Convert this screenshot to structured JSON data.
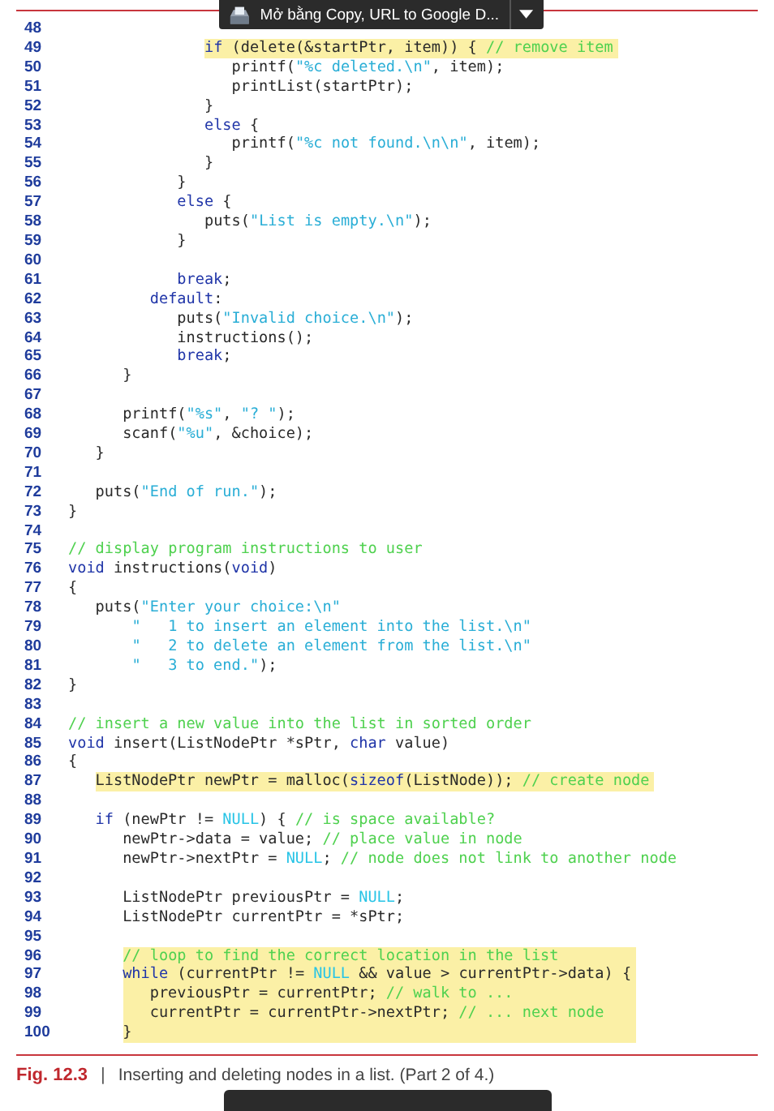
{
  "toolbar": {
    "title": "Mở bằng Copy, URL to Google D..."
  },
  "listing": {
    "lines": [
      {
        "number": "48",
        "highlighted": false
      },
      {
        "number": "49",
        "highlighted": true,
        "segments": [
          {
            "kind": "keyword",
            "text": "               if"
          },
          {
            "kind": "plain",
            "text": " (delete(&startPtr, item)) { "
          },
          {
            "kind": "comment",
            "text": "// remove item"
          }
        ]
      },
      {
        "number": "50",
        "highlighted": false,
        "segments": [
          {
            "kind": "plain",
            "text": "                  printf("
          },
          {
            "kind": "string",
            "text": "\"%c deleted.\\n\""
          },
          {
            "kind": "plain",
            "text": ", item);"
          }
        ]
      },
      {
        "number": "51",
        "highlighted": false,
        "segments": [
          {
            "kind": "plain",
            "text": "                  printList(startPtr);"
          }
        ]
      },
      {
        "number": "52",
        "highlighted": false,
        "segments": [
          {
            "kind": "plain",
            "text": "               }"
          }
        ]
      },
      {
        "number": "53",
        "highlighted": false,
        "segments": [
          {
            "kind": "keyword",
            "text": "               else"
          },
          {
            "kind": "plain",
            "text": " {"
          }
        ]
      },
      {
        "number": "54",
        "highlighted": false,
        "segments": [
          {
            "kind": "plain",
            "text": "                  printf("
          },
          {
            "kind": "string",
            "text": "\"%c not found.\\n\\n\""
          },
          {
            "kind": "plain",
            "text": ", item);"
          }
        ]
      },
      {
        "number": "55",
        "highlighted": false,
        "segments": [
          {
            "kind": "plain",
            "text": "               }"
          }
        ]
      },
      {
        "number": "56",
        "highlighted": false,
        "segments": [
          {
            "kind": "plain",
            "text": "            }"
          }
        ]
      },
      {
        "number": "57",
        "highlighted": false,
        "segments": [
          {
            "kind": "keyword",
            "text": "            else"
          },
          {
            "kind": "plain",
            "text": " {"
          }
        ]
      },
      {
        "number": "58",
        "highlighted": false,
        "segments": [
          {
            "kind": "plain",
            "text": "               puts("
          },
          {
            "kind": "string",
            "text": "\"List is empty.\\n\""
          },
          {
            "kind": "plain",
            "text": ");"
          }
        ]
      },
      {
        "number": "59",
        "highlighted": false,
        "segments": [
          {
            "kind": "plain",
            "text": "            }"
          }
        ]
      },
      {
        "number": "60",
        "highlighted": false
      },
      {
        "number": "61",
        "highlighted": false,
        "segments": [
          {
            "kind": "keyword",
            "text": "            break"
          },
          {
            "kind": "plain",
            "text": ";"
          }
        ]
      },
      {
        "number": "62",
        "highlighted": false,
        "segments": [
          {
            "kind": "keyword",
            "text": "         default"
          },
          {
            "kind": "plain",
            "text": ":"
          }
        ]
      },
      {
        "number": "63",
        "highlighted": false,
        "segments": [
          {
            "kind": "plain",
            "text": "            puts("
          },
          {
            "kind": "string",
            "text": "\"Invalid choice.\\n\""
          },
          {
            "kind": "plain",
            "text": ");"
          }
        ]
      },
      {
        "number": "64",
        "highlighted": false,
        "segments": [
          {
            "kind": "plain",
            "text": "            instructions();"
          }
        ]
      },
      {
        "number": "65",
        "highlighted": false,
        "segments": [
          {
            "kind": "keyword",
            "text": "            break"
          },
          {
            "kind": "plain",
            "text": ";"
          }
        ]
      },
      {
        "number": "66",
        "highlighted": false,
        "segments": [
          {
            "kind": "plain",
            "text": "      }"
          }
        ]
      },
      {
        "number": "67",
        "highlighted": false
      },
      {
        "number": "68",
        "highlighted": false,
        "segments": [
          {
            "kind": "plain",
            "text": "      printf("
          },
          {
            "kind": "string",
            "text": "\"%s\""
          },
          {
            "kind": "plain",
            "text": ", "
          },
          {
            "kind": "string",
            "text": "\"? \""
          },
          {
            "kind": "plain",
            "text": ");"
          }
        ]
      },
      {
        "number": "69",
        "highlighted": false,
        "segments": [
          {
            "kind": "plain",
            "text": "      scanf("
          },
          {
            "kind": "string",
            "text": "\"%u\""
          },
          {
            "kind": "plain",
            "text": ", &choice);"
          }
        ]
      },
      {
        "number": "70",
        "highlighted": false,
        "segments": [
          {
            "kind": "plain",
            "text": "   }"
          }
        ]
      },
      {
        "number": "71",
        "highlighted": false
      },
      {
        "number": "72",
        "highlighted": false,
        "segments": [
          {
            "kind": "plain",
            "text": "   puts("
          },
          {
            "kind": "string",
            "text": "\"End of run.\""
          },
          {
            "kind": "plain",
            "text": ");"
          }
        ]
      },
      {
        "number": "73",
        "highlighted": false,
        "segments": [
          {
            "kind": "plain",
            "text": "}"
          }
        ]
      },
      {
        "number": "74",
        "highlighted": false
      },
      {
        "number": "75",
        "highlighted": false,
        "segments": [
          {
            "kind": "comment",
            "text": "// display program instructions to user"
          }
        ]
      },
      {
        "number": "76",
        "highlighted": false,
        "segments": [
          {
            "kind": "keyword",
            "text": "void"
          },
          {
            "kind": "plain",
            "text": " instructions("
          },
          {
            "kind": "keyword",
            "text": "void"
          },
          {
            "kind": "plain",
            "text": ")"
          }
        ]
      },
      {
        "number": "77",
        "highlighted": false,
        "segments": [
          {
            "kind": "plain",
            "text": "{"
          }
        ]
      },
      {
        "number": "78",
        "highlighted": false,
        "segments": [
          {
            "kind": "plain",
            "text": "   puts("
          },
          {
            "kind": "string",
            "text": "\"Enter your choice:\\n\""
          }
        ]
      },
      {
        "number": "79",
        "highlighted": false,
        "segments": [
          {
            "kind": "string",
            "text": "       \"   1 to insert an element into the list.\\n\""
          }
        ]
      },
      {
        "number": "80",
        "highlighted": false,
        "segments": [
          {
            "kind": "string",
            "text": "       \"   2 to delete an element from the list.\\n\""
          }
        ]
      },
      {
        "number": "81",
        "highlighted": false,
        "segments": [
          {
            "kind": "string",
            "text": "       \"   3 to end.\""
          },
          {
            "kind": "plain",
            "text": ");"
          }
        ]
      },
      {
        "number": "82",
        "highlighted": false,
        "segments": [
          {
            "kind": "plain",
            "text": "}"
          }
        ]
      },
      {
        "number": "83",
        "highlighted": false
      },
      {
        "number": "84",
        "highlighted": false,
        "segments": [
          {
            "kind": "comment",
            "text": "// insert a new value into the list in sorted order"
          }
        ]
      },
      {
        "number": "85",
        "highlighted": false,
        "segments": [
          {
            "kind": "keyword",
            "text": "void"
          },
          {
            "kind": "plain",
            "text": " insert(ListNodePtr *sPtr, "
          },
          {
            "kind": "keyword",
            "text": "char"
          },
          {
            "kind": "plain",
            "text": " value)"
          }
        ]
      },
      {
        "number": "86",
        "highlighted": false,
        "segments": [
          {
            "kind": "plain",
            "text": "{"
          }
        ]
      },
      {
        "number": "87",
        "highlighted": true,
        "segments": [
          {
            "kind": "plain",
            "text": "   ListNodePtr newPtr = malloc("
          },
          {
            "kind": "keyword",
            "text": "sizeof"
          },
          {
            "kind": "plain",
            "text": "(ListNode)); "
          },
          {
            "kind": "comment",
            "text": "// create node"
          }
        ]
      },
      {
        "number": "88",
        "highlighted": false
      },
      {
        "number": "89",
        "highlighted": false,
        "segments": [
          {
            "kind": "keyword",
            "text": "   if"
          },
          {
            "kind": "plain",
            "text": " (newPtr != "
          },
          {
            "kind": "constant",
            "text": "NULL"
          },
          {
            "kind": "plain",
            "text": ") { "
          },
          {
            "kind": "comment",
            "text": "// is space available?"
          }
        ]
      },
      {
        "number": "90",
        "highlighted": false,
        "segments": [
          {
            "kind": "plain",
            "text": "      newPtr->data = value; "
          },
          {
            "kind": "comment",
            "text": "// place value in node"
          }
        ]
      },
      {
        "number": "91",
        "highlighted": false,
        "segments": [
          {
            "kind": "plain",
            "text": "      newPtr->nextPtr = "
          },
          {
            "kind": "constant",
            "text": "NULL"
          },
          {
            "kind": "plain",
            "text": "; "
          },
          {
            "kind": "comment",
            "text": "// node does not link to another node"
          }
        ]
      },
      {
        "number": "92",
        "highlighted": false
      },
      {
        "number": "93",
        "highlighted": false,
        "segments": [
          {
            "kind": "plain",
            "text": "      ListNodePtr previousPtr = "
          },
          {
            "kind": "constant",
            "text": "NULL"
          },
          {
            "kind": "plain",
            "text": ";"
          }
        ]
      },
      {
        "number": "94",
        "highlighted": false,
        "segments": [
          {
            "kind": "plain",
            "text": "      ListNodePtr currentPtr = *sPtr;"
          }
        ]
      },
      {
        "number": "95",
        "highlighted": false
      },
      {
        "number": "96",
        "highlighted": true,
        "segments": [
          {
            "kind": "comment",
            "text": "      // loop to find the correct location in the list"
          }
        ]
      },
      {
        "number": "97",
        "highlighted": true,
        "segments": [
          {
            "kind": "keyword",
            "text": "      while"
          },
          {
            "kind": "plain",
            "text": " (currentPtr != "
          },
          {
            "kind": "constant",
            "text": "NULL"
          },
          {
            "kind": "plain",
            "text": " && value > currentPtr->data) {"
          }
        ]
      },
      {
        "number": "98",
        "highlighted": true,
        "segments": [
          {
            "kind": "plain",
            "text": "         previousPtr = currentPtr; "
          },
          {
            "kind": "comment",
            "text": "// walk to ..."
          }
        ]
      },
      {
        "number": "99",
        "highlighted": true,
        "segments": [
          {
            "kind": "plain",
            "text": "         currentPtr = currentPtr->nextPtr; "
          },
          {
            "kind": "comment",
            "text": "// ... next node"
          }
        ]
      },
      {
        "number": "100",
        "highlighted": true,
        "segments": [
          {
            "kind": "plain",
            "text": "      }"
          }
        ]
      }
    ]
  },
  "caption": {
    "label": "Fig. 12.3",
    "separator": "|",
    "text": "Inserting and deleting nodes in a list. (Part 2 of 4.)"
  }
}
